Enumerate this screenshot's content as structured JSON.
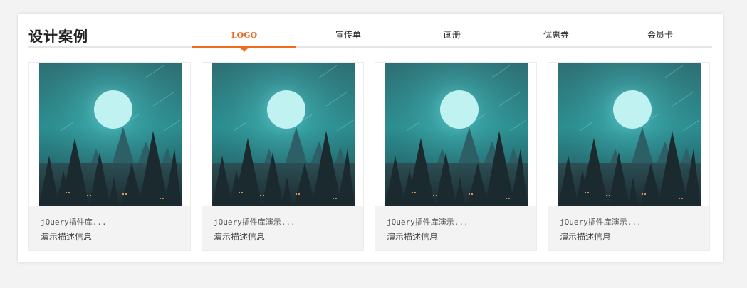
{
  "section": {
    "title": "设计案例"
  },
  "tabs": [
    {
      "label": "LOGO",
      "active": true
    },
    {
      "label": "宣传单",
      "active": false
    },
    {
      "label": "画册",
      "active": false
    },
    {
      "label": "优惠券",
      "active": false
    },
    {
      "label": "会员卡",
      "active": false
    }
  ],
  "cards": [
    {
      "title": "jQuery插件库...",
      "description": "演示描述信息"
    },
    {
      "title": "jQuery插件库演示...",
      "description": "演示描述信息"
    },
    {
      "title": "jQuery插件库演示...",
      "description": "演示描述信息"
    },
    {
      "title": "jQuery插件库演示...",
      "description": "演示描述信息"
    }
  ],
  "colors": {
    "accent": "#ef6b1e",
    "rule": "#e5e5e5",
    "card_bg": "#f3f3f3"
  }
}
